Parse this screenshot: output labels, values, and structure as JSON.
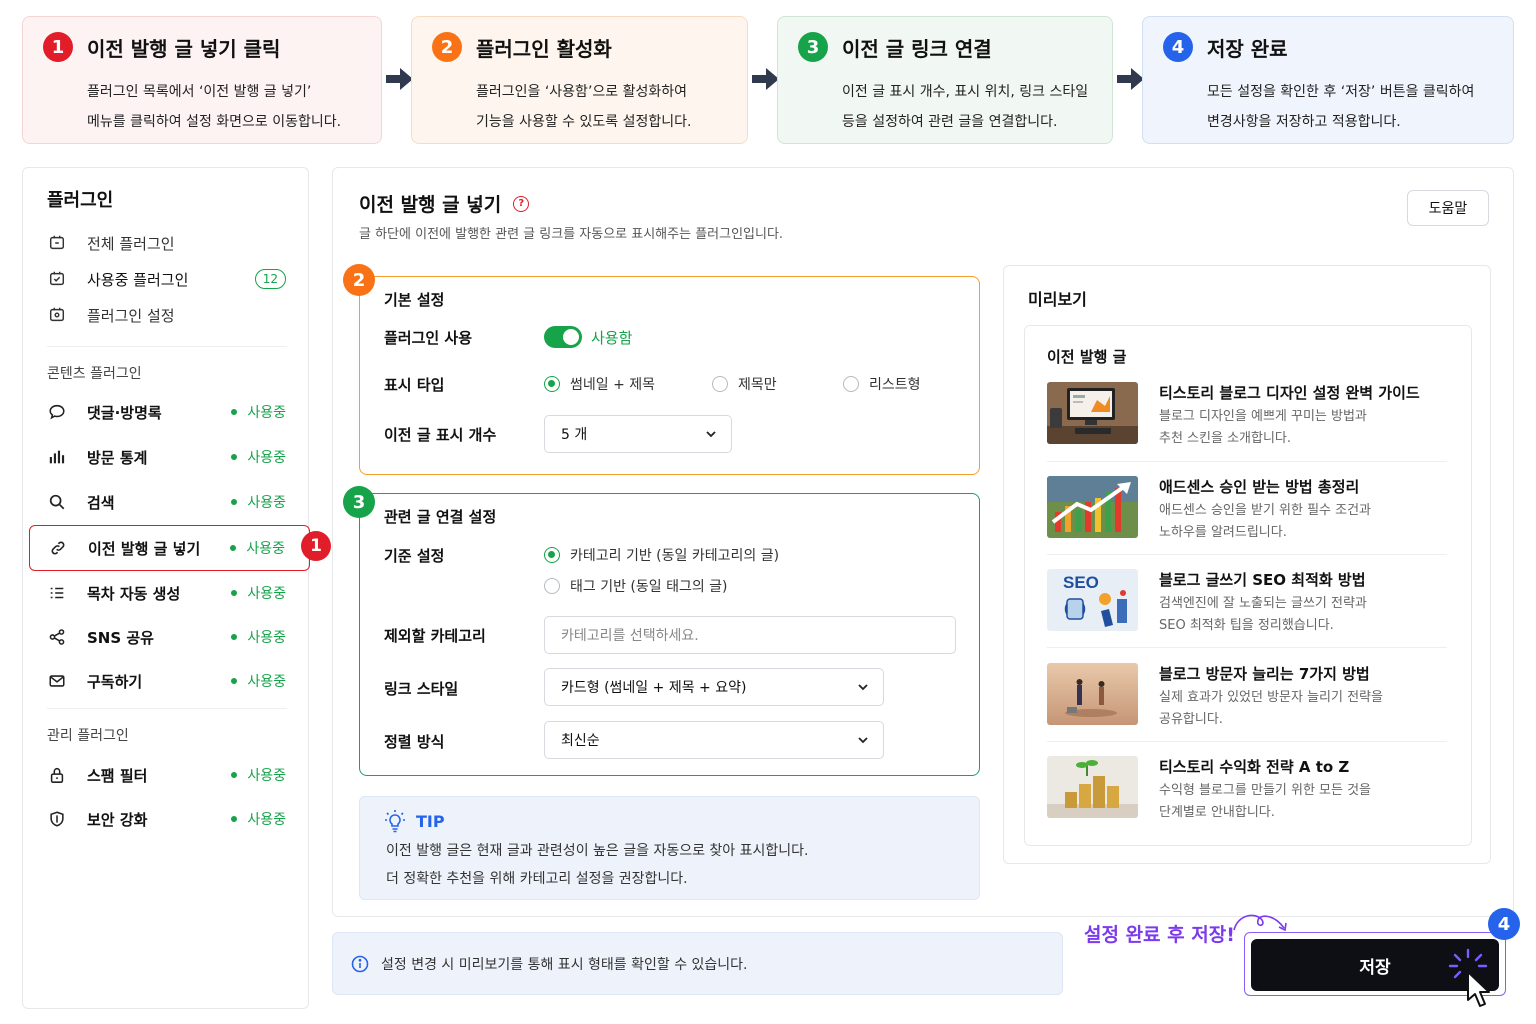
{
  "steps": [
    {
      "num": "1",
      "title": "이전 발행 글 넣기 클릭",
      "line1": "플러그인 목록에서 ‘이전 발행 글 넣기’",
      "line2": "메뉴를 클릭하여 설정 화면으로 이동합니다.",
      "color": "#e11d2a",
      "bg": "#fdf3f3",
      "border": "#f6d4d4"
    },
    {
      "num": "2",
      "title": "플러그인 활성화",
      "line1": "플러그인을 ‘사용함’으로 활성화하여",
      "line2": "기능을 사용할 수 있도록 설정합니다.",
      "color": "#f97316",
      "bg": "#fef6ee",
      "border": "#f8dcc0"
    },
    {
      "num": "3",
      "title": "이전 글 링크 연결",
      "line1": "이전 글 표시 개수, 표시 위치, 링크 스타일",
      "line2": "등을 설정하여 관련 글을 연결합니다.",
      "color": "#16a34a",
      "bg": "#f1f8f3",
      "border": "#cfe6d6"
    },
    {
      "num": "4",
      "title": "저장 완료",
      "line1": "모든 설정을 확인한 후 ‘저장’ 버튼을 클릭하여",
      "line2": "변경사항을 저장하고 적용합니다.",
      "color": "#2563eb",
      "bg": "#f0f4fc",
      "border": "#d3dff3"
    }
  ],
  "sidebar": {
    "title": "플러그인",
    "top_items": [
      {
        "label": "전체 플러그인",
        "icon": "plugin-icon"
      },
      {
        "label": "사용중 플러그인",
        "icon": "plugin-active-icon",
        "badge": "12"
      },
      {
        "label": "플러그인 설정",
        "icon": "plugin-settings-icon"
      }
    ],
    "group_content": "콘텐츠 플러그인",
    "content_items": [
      {
        "label": "댓글·방명록",
        "icon": "comment-icon",
        "status": "사용중"
      },
      {
        "label": "방문 통계",
        "icon": "bar-chart-icon",
        "status": "사용중"
      },
      {
        "label": "검색",
        "icon": "search-icon",
        "status": "사용중"
      },
      {
        "label": "이전 발행 글 넣기",
        "icon": "link-icon",
        "status": "사용중"
      },
      {
        "label": "목차 자동 생성",
        "icon": "list-icon",
        "status": "사용중"
      },
      {
        "label": "SNS 공유",
        "icon": "share-icon",
        "status": "사용중"
      },
      {
        "label": "구독하기",
        "icon": "mail-icon",
        "status": "사용중"
      }
    ],
    "group_manage": "관리 플러그인",
    "manage_items": [
      {
        "label": "스팸 필터",
        "icon": "lock-icon",
        "status": "사용중"
      },
      {
        "label": "보안 강화",
        "icon": "shield-icon",
        "status": "사용중"
      }
    ],
    "active_badge": "1"
  },
  "main": {
    "title": "이전 발행 글 넣기",
    "help_mark": "?",
    "subtitle": "글 하단에 이전에 발행한 관련 글 링크를 자동으로 표시해주는 플러그인입니다.",
    "help_button": "도움말",
    "basic": {
      "num": "2",
      "title": "기본 설정",
      "enable_label": "플러그인 사용",
      "enable_value": "사용함",
      "type_label": "표시 타입",
      "type_options": [
        "썸네일 + 제목",
        "제목만",
        "리스트형"
      ],
      "count_label": "이전 글 표시 개수",
      "count_value": "5 개"
    },
    "link": {
      "num": "3",
      "title": "관련 글 연결 설정",
      "basis_label": "기준 설정",
      "basis_options": [
        "카테고리 기반 (동일 카테고리의 글)",
        "태그 기반 (동일 태그의 글)"
      ],
      "exclude_label": "제외할 카테고리",
      "exclude_placeholder": "카테고리를 선택하세요.",
      "style_label": "링크 스타일",
      "style_value": "카드형 (썸네일 + 제목 + 요약)",
      "sort_label": "정렬 방식",
      "sort_value": "최신순"
    },
    "tip": {
      "title": "TIP",
      "line1": "이전 발행 글은 현재 글과 관련성이 높은 글을 자동으로 찾아 표시합니다.",
      "line2": "더 정확한 추천을 위해 카테고리 설정을 권장합니다."
    }
  },
  "preview": {
    "title": "미리보기",
    "inner_title": "이전 발행 글",
    "posts": [
      {
        "title": "티스토리 블로그 디자인 설정 완벽 가이드",
        "line1": "블로그 디자인을 예쁘게 꾸미는 방법과",
        "line2": "추천 스킨을 소개합니다."
      },
      {
        "title": "애드센스 승인 받는 방법 총정리",
        "line1": "애드센스 승인을 받기 위한 필수 조건과",
        "line2": "노하우를 알려드립니다."
      },
      {
        "title": "블로그 글쓰기 SEO 최적화 방법",
        "line1": "검색엔진에 잘 노출되는 글쓰기 전략과",
        "line2": "SEO 최적화 팁을 정리했습니다.",
        "thumb_text": "SEO"
      },
      {
        "title": "블로그 방문자 늘리는 7가지 방법",
        "line1": "실제 효과가 있었던 방문자 늘리기 전략을",
        "line2": "공유합니다."
      },
      {
        "title": "티스토리 수익화 전략 A to Z",
        "line1": "수익형 블로그를 만들기 위한 모든 것을",
        "line2": "단계별로 안내합니다."
      }
    ]
  },
  "footer": {
    "notice": "설정 변경 시 미리보기를 통해 표시 형태를 확인할 수 있습니다.",
    "save_hint": "설정 완료 후 저장!",
    "save_button": "저장",
    "save_badge": "4"
  }
}
